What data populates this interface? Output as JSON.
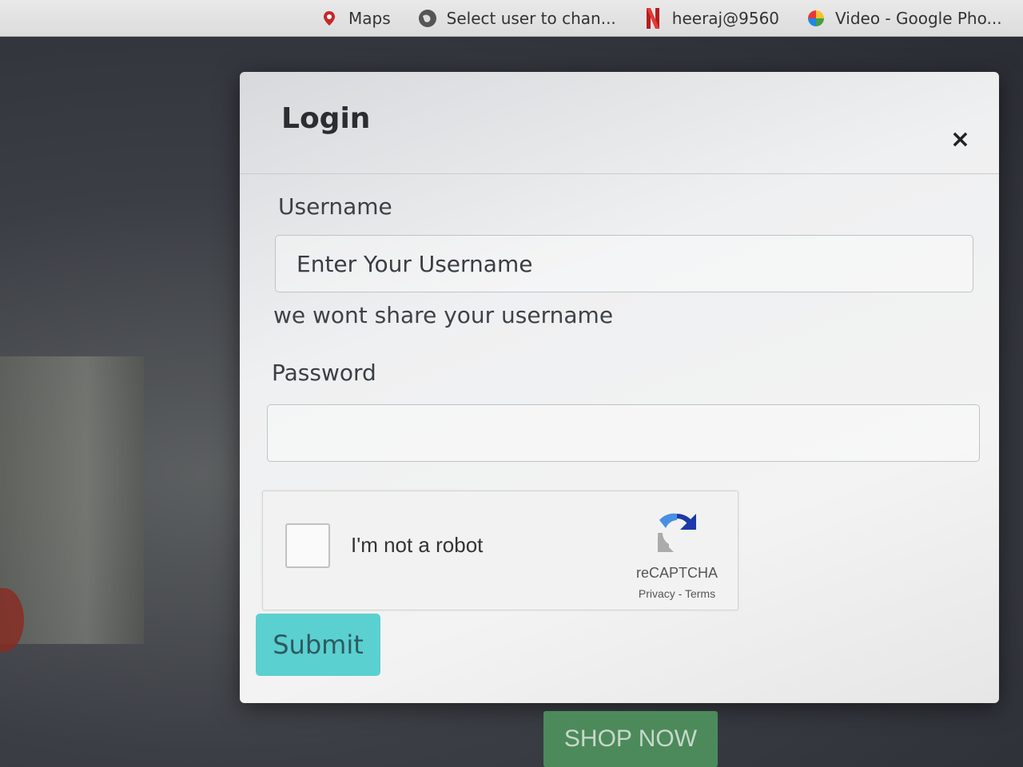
{
  "bookmarks": [
    {
      "icon": "maps-icon",
      "label": "Maps"
    },
    {
      "icon": "globe-icon",
      "label": "Select user to chan..."
    },
    {
      "icon": "netflix-icon",
      "label": "heeraj@9560"
    },
    {
      "icon": "google-photos-icon",
      "label": "Video - Google Pho..."
    }
  ],
  "modal": {
    "title": "Login",
    "close_symbol": "×",
    "username": {
      "label": "Username",
      "placeholder": "Enter Your Username",
      "help": "we wont share your username"
    },
    "password": {
      "label": "Password",
      "value": ""
    },
    "recaptcha": {
      "label": "I'm not a robot",
      "brand": "reCAPTCHA",
      "links": "Privacy - Terms"
    },
    "submit_label": "Submit"
  },
  "background": {
    "shop_now_label": "SHOP NOW"
  },
  "colors": {
    "submit_bg": "#5bd0d0",
    "shop_now_bg": "#4c8a5b",
    "recaptcha_blue": "#4a90e2"
  }
}
